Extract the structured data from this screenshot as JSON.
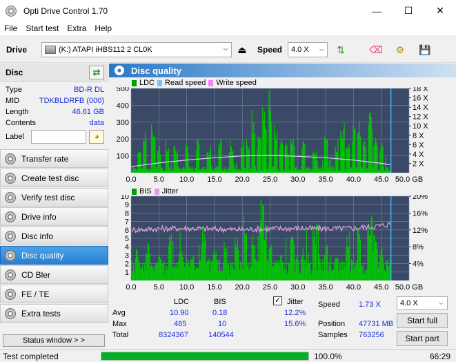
{
  "window": {
    "title": "Opti Drive Control 1.70",
    "minimize_label": "—",
    "maximize_label": "☐",
    "close_label": "✕"
  },
  "menu": [
    {
      "label": "File",
      "accel": "F"
    },
    {
      "label": "Start test",
      "accel": "S"
    },
    {
      "label": "Extra",
      "accel": "E"
    },
    {
      "label": "Help",
      "accel": "H"
    }
  ],
  "toolbar": {
    "drive_label": "Drive",
    "drive_value": "(K:)  ATAPI iHBS112   2 CL0K",
    "speed_label": "Speed",
    "speed_value": "4.0 X"
  },
  "disc": {
    "header": "Disc",
    "rows": [
      {
        "key": "Type",
        "value": "BD-R DL"
      },
      {
        "key": "MID",
        "value": "TDKBLDRFB (000)"
      },
      {
        "key": "Length",
        "value": "46.61 GB"
      },
      {
        "key": "Contents",
        "value": "data"
      }
    ],
    "label_key": "Label",
    "label_value": ""
  },
  "nav": [
    {
      "label": "Transfer rate",
      "active": false
    },
    {
      "label": "Create test disc",
      "active": false
    },
    {
      "label": "Verify test disc",
      "active": false
    },
    {
      "label": "Drive info",
      "active": false
    },
    {
      "label": "Disc info",
      "active": false
    },
    {
      "label": "Disc quality",
      "active": true
    },
    {
      "label": "CD Bler",
      "active": false
    },
    {
      "label": "FE / TE",
      "active": false
    },
    {
      "label": "Extra tests",
      "active": false
    }
  ],
  "status_window_label": "Status window > >",
  "panel": {
    "title": "Disc quality"
  },
  "chart_data": [
    {
      "type": "bar",
      "title": "LDC / Read speed / Write speed",
      "legend": [
        "LDC",
        "Read speed",
        "Write speed"
      ],
      "legend_colors": {
        "LDC": "#00a000",
        "Read speed": "#80c0ff",
        "Write speed": "#ff80ff"
      },
      "xlabel": "GB",
      "x_ticks": [
        "0.0",
        "5.0",
        "10.0",
        "15.0",
        "20.0",
        "25.0",
        "30.0",
        "35.0",
        "40.0",
        "45.0",
        "50.0 GB"
      ],
      "xlim": [
        0,
        50
      ],
      "y_left_ticks": [
        "100",
        "200",
        "300",
        "400",
        "500"
      ],
      "ylim_left": [
        0,
        500
      ],
      "y_right_ticks": [
        "2 X",
        "4 X",
        "6 X",
        "8 X",
        "10 X",
        "12 X",
        "14 X",
        "16 X",
        "18 X"
      ],
      "ylim_right": [
        0,
        18
      ],
      "disc_end_gb": 46.61,
      "ldc_baseline": 30,
      "ldc_peaks_gb": [
        [
          1.5,
          180
        ],
        [
          2.5,
          250
        ],
        [
          4,
          300
        ],
        [
          5,
          170
        ],
        [
          6.5,
          210
        ],
        [
          8,
          180
        ],
        [
          10,
          190
        ],
        [
          12,
          200
        ],
        [
          14,
          170
        ],
        [
          16,
          210
        ],
        [
          18,
          200
        ],
        [
          20,
          240
        ],
        [
          21,
          200
        ],
        [
          22,
          380
        ],
        [
          23,
          230
        ],
        [
          24,
          420
        ],
        [
          25,
          485
        ],
        [
          26,
          300
        ],
        [
          27,
          210
        ],
        [
          28,
          170
        ],
        [
          29,
          200
        ],
        [
          31,
          210
        ],
        [
          33,
          180
        ],
        [
          35,
          230
        ],
        [
          37,
          200
        ],
        [
          38,
          310
        ],
        [
          39,
          230
        ],
        [
          40,
          300
        ],
        [
          41,
          340
        ],
        [
          42,
          200
        ],
        [
          43,
          370
        ],
        [
          44,
          230
        ],
        [
          45,
          200
        ]
      ],
      "read_speed_curve": [
        [
          0,
          1.3
        ],
        [
          5,
          2.1
        ],
        [
          10,
          2.7
        ],
        [
          15,
          3.2
        ],
        [
          20,
          3.6
        ],
        [
          25,
          3.7
        ],
        [
          30,
          3.5
        ],
        [
          35,
          3.2
        ],
        [
          40,
          2.7
        ],
        [
          45,
          2.0
        ],
        [
          46.6,
          1.7
        ]
      ]
    },
    {
      "type": "bar",
      "title": "BIS / Jitter",
      "legend": [
        "BIS",
        "Jitter"
      ],
      "legend_colors": {
        "BIS": "#00a000",
        "Jitter": "#e0a0e0"
      },
      "xlabel": "GB",
      "x_ticks": [
        "0.0",
        "5.0",
        "10.0",
        "15.0",
        "20.0",
        "25.0",
        "30.0",
        "35.0",
        "40.0",
        "45.0",
        "50.0 GB"
      ],
      "xlim": [
        0,
        50
      ],
      "y_left_ticks": [
        "1",
        "2",
        "3",
        "4",
        "5",
        "6",
        "7",
        "8",
        "9",
        "10"
      ],
      "ylim_left": [
        0,
        10
      ],
      "y_right_ticks": [
        "4%",
        "8%",
        "12%",
        "16%",
        "20%"
      ],
      "ylim_right": [
        0,
        20
      ],
      "disc_end_gb": 46.61,
      "bis_baseline": 2,
      "bis_peaks_gb": [
        [
          1,
          4
        ],
        [
          3,
          5
        ],
        [
          5,
          3
        ],
        [
          7,
          6
        ],
        [
          9,
          4
        ],
        [
          11,
          3
        ],
        [
          13,
          7
        ],
        [
          15,
          4
        ],
        [
          17,
          5
        ],
        [
          19,
          6
        ],
        [
          20.5,
          8
        ],
        [
          22,
          6
        ],
        [
          23.5,
          10
        ],
        [
          24,
          7
        ],
        [
          25,
          5
        ],
        [
          27,
          3
        ],
        [
          29,
          6
        ],
        [
          31,
          4
        ],
        [
          33,
          7
        ],
        [
          35,
          5
        ],
        [
          37,
          3
        ],
        [
          39,
          6
        ],
        [
          41,
          7
        ],
        [
          43,
          8
        ],
        [
          44,
          6
        ],
        [
          45,
          4
        ]
      ],
      "jitter_curve": [
        [
          0,
          12.0
        ],
        [
          5,
          12.3
        ],
        [
          10,
          12.4
        ],
        [
          15,
          12.2
        ],
        [
          20,
          12.1
        ],
        [
          25,
          12.3
        ],
        [
          30,
          12.4
        ],
        [
          35,
          12.3
        ],
        [
          40,
          12.4
        ],
        [
          45,
          13.0
        ],
        [
          46.6,
          13.4
        ]
      ]
    }
  ],
  "stats": {
    "col_ldc": "LDC",
    "col_bis": "BIS",
    "rows": [
      {
        "label": "Avg",
        "ldc": "10.90",
        "bis": "0.18"
      },
      {
        "label": "Max",
        "ldc": "485",
        "bis": "10"
      },
      {
        "label": "Total",
        "ldc": "8324367",
        "bis": "140544"
      }
    ],
    "jitter_label": "Jitter",
    "jitter_checked": true,
    "jitter_avg": "12.2%",
    "jitter_max": "15.6%",
    "speed_label": "Speed",
    "speed_value": "1.73 X",
    "position_label": "Position",
    "position_value": "47731 MB",
    "samples_label": "Samples",
    "samples_value": "763256",
    "speed_select": "4.0 X",
    "start_full_label": "Start full",
    "start_part_label": "Start part"
  },
  "statusbar": {
    "status_text": "Test completed",
    "progress_percent": 100.0,
    "progress_label": "100.0%",
    "time": "66:29"
  }
}
